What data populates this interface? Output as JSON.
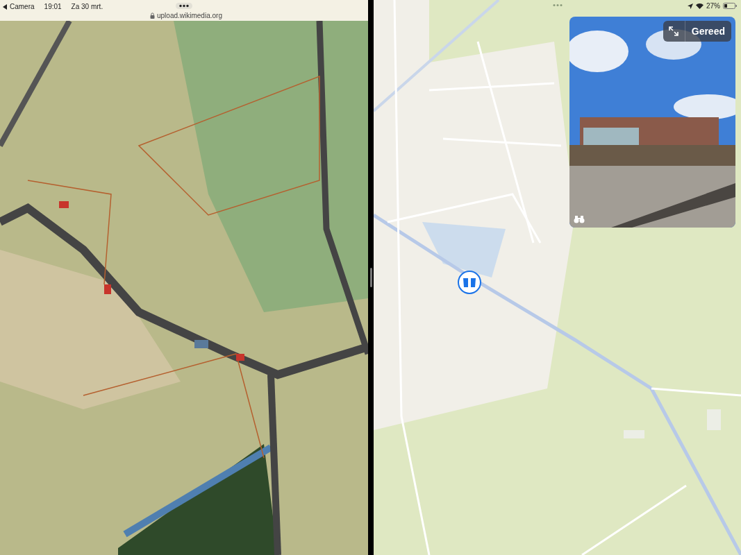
{
  "left_pane": {
    "status_bar": {
      "back_label": "Camera",
      "time": "19:01",
      "date": "Za 30 mrt."
    },
    "address": "upload.wikimedia.org"
  },
  "right_pane": {
    "status_bar": {
      "battery": "27%"
    },
    "look_around": {
      "done_button": "Gereed"
    }
  }
}
